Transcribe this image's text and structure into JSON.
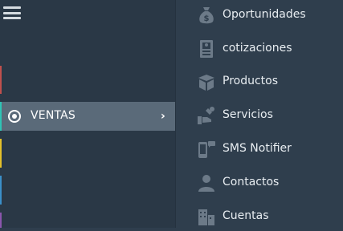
{
  "colors": {
    "background": "#2f3e4d",
    "left_panel": "#2a3846",
    "active_item": "#5a6a79",
    "icon": "#6c7a88",
    "strip_red": "#c0504d",
    "strip_yellow": "#e4c02a",
    "strip_blue": "#3b8fc9",
    "strip_purple": "#8a56ad",
    "marker_teal": "#2ec4b6"
  },
  "nav": {
    "menu_icon": "hamburger-icon",
    "active_item": {
      "label": "VENTAS",
      "icon": "radio-selected-icon",
      "chevron": "›"
    }
  },
  "submenu": {
    "items": [
      {
        "label": "Oportunidades",
        "icon": "money-bag-icon"
      },
      {
        "label": "cotizaciones",
        "icon": "document-icon"
      },
      {
        "label": "Productos",
        "icon": "box-icon"
      },
      {
        "label": "Servicios",
        "icon": "wrench-hand-icon"
      },
      {
        "label": "SMS Notifier",
        "icon": "phone-message-icon"
      },
      {
        "label": "Contactos",
        "icon": "user-icon"
      },
      {
        "label": "Cuentas",
        "icon": "building-icon"
      }
    ]
  }
}
